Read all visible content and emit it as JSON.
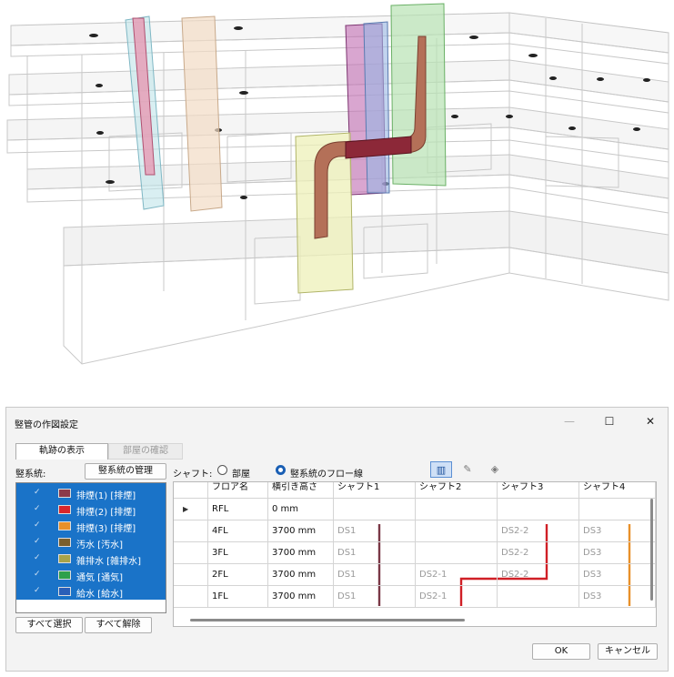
{
  "dialog": {
    "title": "竪管の作図設定",
    "controls": {
      "minimize": "—",
      "maximize": "☐",
      "close": "✕"
    },
    "tabs": {
      "track": "軌跡の表示",
      "room": "部屋の確認"
    },
    "systems_label": "竪系統:",
    "manage_button": "竪系統の管理",
    "systems": [
      {
        "label": "排煙(1) [排煙]",
        "color": "#8c3a4a",
        "checked": true
      },
      {
        "label": "排煙(2) [排煙]",
        "color": "#d8262b",
        "checked": true
      },
      {
        "label": "排煙(3) [排煙]",
        "color": "#e8902a",
        "checked": true
      },
      {
        "label": "汚水 [汚水]",
        "color": "#7a5f2e",
        "checked": true
      },
      {
        "label": "雑排水 [雑排水]",
        "color": "#a8a34a",
        "checked": true
      },
      {
        "label": "通気 [通気]",
        "color": "#2ea04a",
        "checked": true
      },
      {
        "label": "給水 [給水]",
        "color": "#2a5fb8",
        "checked": true
      }
    ],
    "select_all": "すべて選択",
    "deselect_all": "すべて解除",
    "shaft_label": "シャフト:",
    "shaft_mode": {
      "room": "部屋",
      "flow": "竪系統のフロー線",
      "selected": "flow"
    },
    "tool_icons": [
      "grid-icon",
      "pencil-icon",
      "eraser-icon"
    ],
    "table": {
      "headers": [
        "フロア名",
        "横引き高さ",
        "シャフト1",
        "シャフト2",
        "シャフト3",
        "シャフト4"
      ],
      "rows": [
        {
          "floor": "RFL",
          "height": "0 mm",
          "s1": "",
          "s2": "",
          "s3": "",
          "s4": "",
          "current": true
        },
        {
          "floor": "4FL",
          "height": "3700 mm",
          "s1": "DS1",
          "s2": "",
          "s3": "DS2-2",
          "s4": "DS3"
        },
        {
          "floor": "3FL",
          "height": "3700 mm",
          "s1": "DS1",
          "s2": "",
          "s3": "DS2-2",
          "s4": "DS3"
        },
        {
          "floor": "2FL",
          "height": "3700 mm",
          "s1": "DS1",
          "s2": "DS2-1",
          "s3": "DS2-2",
          "s4": "DS3"
        },
        {
          "floor": "1FL",
          "height": "3700 mm",
          "s1": "DS1",
          "s2": "DS2-1",
          "s3": "",
          "s4": "DS3"
        }
      ],
      "flow_colors": {
        "s1": "#7a3846",
        "s2_s3": "#d01f26",
        "s4": "#e8902a"
      }
    },
    "ok": "OK",
    "cancel": "キャンセル"
  }
}
